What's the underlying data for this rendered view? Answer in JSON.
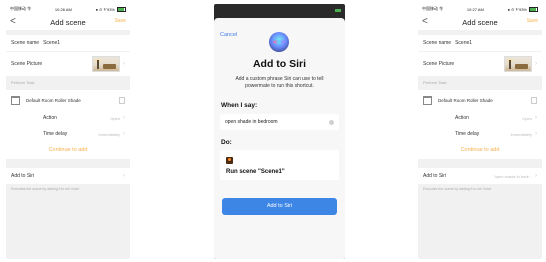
{
  "screen1": {
    "status": {
      "carrier": "中国移动 令",
      "time": "10:26 AM",
      "battery": "● ⊙ ⅟ 93%"
    },
    "nav": {
      "back": "<",
      "title": "Add scene",
      "save": "Save"
    },
    "scene_name_label": "Scene name",
    "scene_name_value": "Scene1",
    "scene_picture_label": "Scene Picture",
    "perform_task_label": "Perform Task",
    "device_name": "Default Room Roller Shade",
    "action_label": "Action",
    "action_value": "Open",
    "delay_label": "Time delay",
    "delay_value": "Immediately",
    "continue_label": "Continue to add",
    "siri_label": "Add to Siri",
    "siri_value": "",
    "footnote": "Executes the scene by adding it to siri Voice"
  },
  "screen2": {
    "cancel": "Cancel",
    "title": "Add to Siri",
    "description": "Add a custom phrase Siri can use to tell powermate to run this shortcut.",
    "when_label": "When I say:",
    "phrase": "open shade in bedroom",
    "do_label": "Do:",
    "run_text": "Run scene \"Scene1\"",
    "button": "Add to Siri"
  },
  "screen3": {
    "status": {
      "carrier": "中国移动 令",
      "time": "10:27 AM",
      "battery": "● ⊙ ⅟ 93%"
    },
    "nav": {
      "back": "<",
      "title": "Add scene",
      "save": "Save"
    },
    "scene_name_label": "Scene name",
    "scene_name_value": "Scene1",
    "scene_picture_label": "Scene Picture",
    "perform_task_label": "Perform Task",
    "device_name": "Default Room Roller Shade",
    "action_label": "Action",
    "action_value": "Open",
    "delay_label": "Time delay",
    "delay_value": "Immediately",
    "continue_label": "Continue to add",
    "siri_label": "Add to Siri",
    "siri_value": "\"open shade in bedr...",
    "footnote": "Executes the scene by adding it to siri Voice"
  }
}
